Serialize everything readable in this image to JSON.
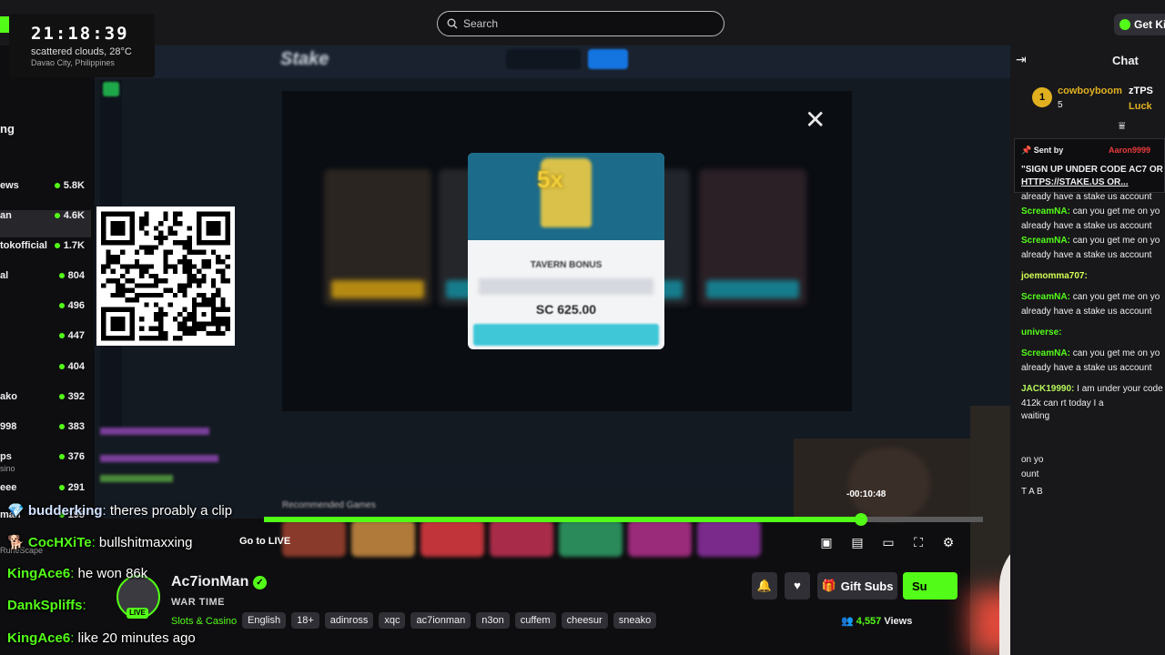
{
  "clock": {
    "time": "21:18:39",
    "weather": "scattered clouds, 28°C",
    "location": "Davao City, Philippines"
  },
  "search": {
    "placeholder": "Search"
  },
  "header": {
    "get_kick": "Get Ki"
  },
  "sidebar": {
    "title": "ng",
    "channels": [
      {
        "name": "ews",
        "sub": "",
        "count": "5.8K"
      },
      {
        "name": "an",
        "sub": "",
        "count": "4.6K"
      },
      {
        "name": "tokofficial",
        "sub": "",
        "count": "1.7K"
      },
      {
        "name": "al",
        "sub": "",
        "count": "804"
      },
      {
        "name": "",
        "sub": "",
        "count": "496"
      },
      {
        "name": "",
        "sub": "",
        "count": "447"
      },
      {
        "name": "",
        "sub": "",
        "count": "404"
      },
      {
        "name": "ako",
        "sub": "",
        "count": "392"
      },
      {
        "name": "998",
        "sub": "",
        "count": "383"
      },
      {
        "name": "ps",
        "sub": "sino",
        "count": "376"
      },
      {
        "name": "eee",
        "sub": "",
        "count": "291"
      },
      {
        "name": "man",
        "sub": "",
        "count": "195"
      },
      {
        "name": "",
        "sub": "RuneScape",
        "count": ""
      }
    ]
  },
  "game": {
    "brand": "Stake",
    "modal_title": "TAVERN BONUS",
    "modal_amount": "SC 625.00",
    "multiplier": "5x",
    "recommended": "Recommended Games"
  },
  "player": {
    "timecode": "-00:10:48",
    "progress": 0.83,
    "go_to_live": "Go to LIVE"
  },
  "overlay_chat": [
    {
      "user": "budderking",
      "msg": " theres proably a clip",
      "color": "#cfe0ff"
    },
    {
      "user": "CocHXiTe",
      "msg": " bullshitmaxxing",
      "color": "#53fc18"
    },
    {
      "user": "KingAce6",
      "msg": " he won 86k",
      "color": "#53fc18"
    },
    {
      "user": "DankSpliffs",
      "msg": "",
      "color": "#53fc18"
    },
    {
      "user": "KingAce6",
      "msg": " like 20 minutes ago",
      "color": "#53fc18"
    }
  ],
  "stream": {
    "streamer": "Ac7ionMan",
    "title": "WAR TIME",
    "category": "Slots & Casino",
    "tags": [
      "English",
      "18+",
      "adinross",
      "xqc",
      "ac7ionman",
      "n3on",
      "cuffem",
      "cheesur",
      "sneako"
    ],
    "viewers": "4,557",
    "viewers_label": "Views",
    "live_badge": "LIVE",
    "gift_subs": "Gift Subs",
    "subscribe": "Su"
  },
  "chat": {
    "title": "Chat",
    "leaderboard": {
      "rank": "1",
      "name": "cowboyboom",
      "count": "5",
      "second": "zTPS",
      "third": "Luck"
    },
    "pinned": {
      "sent_by": "Sent by",
      "sender": "Aaron9999",
      "message": "\"SIGN UP UNDER CODE AC7 OR",
      "link": "HTTPS://STAKE.US OR..."
    },
    "messages": [
      {
        "user": "",
        "text": "already have a stake us account",
        "cls": "u"
      },
      {
        "user": "ScreamNA:",
        "text": " can you get me on yo",
        "cls": "u"
      },
      {
        "user": "",
        "text": "already have a stake us account",
        "cls": "u"
      },
      {
        "user": "ScreamNA:",
        "text": " can you get me on yo",
        "cls": "u"
      },
      {
        "user": "",
        "text": "already have a stake us account",
        "cls": "u"
      },
      {
        "user": "joemomma707:",
        "text": "",
        "cls": "uy"
      },
      {
        "user": "ScreamNA:",
        "text": " can you get me on yo",
        "cls": "u"
      },
      {
        "user": "",
        "text": "already have a stake us account",
        "cls": "u"
      },
      {
        "user": "universe:",
        "text": "",
        "cls": "u"
      },
      {
        "user": "ScreamNA:",
        "text": " can you get me on yo",
        "cls": "u"
      },
      {
        "user": "",
        "text": "already have a stake us account",
        "cls": "u"
      },
      {
        "user": "JACK19990:",
        "text": " I am under your code",
        "cls": "u2"
      },
      {
        "user": "",
        "text": "412k can  rt today I a",
        "cls": "u"
      },
      {
        "user": "",
        "text": "waiting",
        "cls": "u"
      },
      {
        "user": "",
        "text": "",
        "cls": "u"
      },
      {
        "user": "",
        "text": "on yo",
        "cls": "u"
      },
      {
        "user": "",
        "text": "ount",
        "cls": "u"
      },
      {
        "user": "",
        "text": "T A B",
        "cls": "u"
      }
    ]
  },
  "colors": {
    "accent": "#53fc18",
    "bg": "#0e0e10",
    "panel": "#18181b"
  }
}
